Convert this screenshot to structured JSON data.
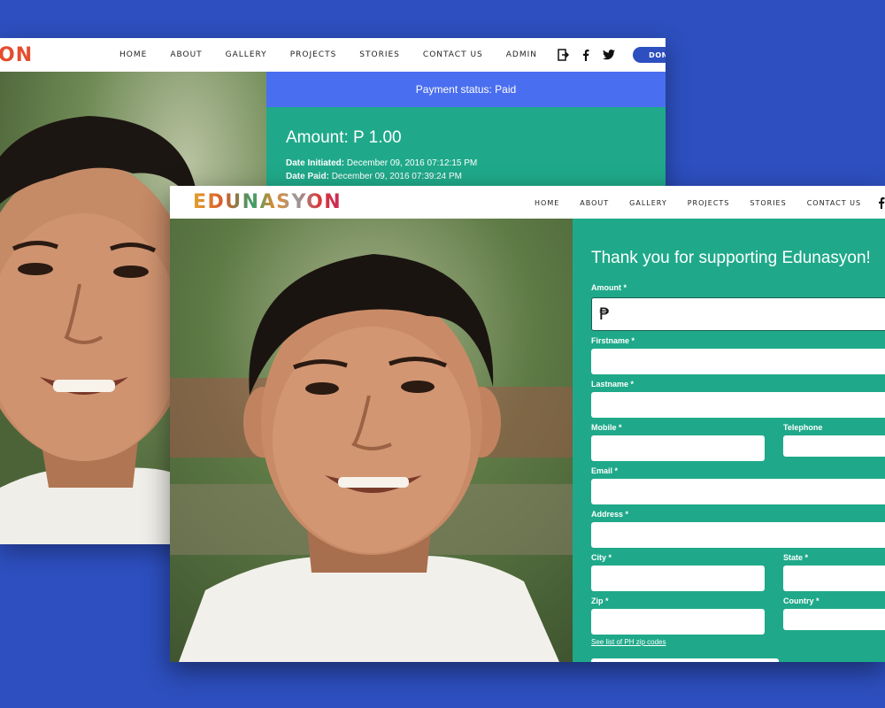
{
  "back": {
    "logo_visible": "ON",
    "nav": [
      "HOME",
      "ABOUT",
      "GALLERY",
      "PROJECTS",
      "STORIES",
      "CONTACT US",
      "ADMIN"
    ],
    "icons": [
      "logout-icon",
      "facebook-icon",
      "twitter-icon"
    ],
    "donate_label": "DONATE",
    "status_text": "Payment status: Paid",
    "amount_text": "Amount: P 1.00",
    "date_initiated_label": "Date Initiated:",
    "date_initiated_value": "December 09, 2016 07:12:15 PM",
    "date_paid_label": "Date Paid:",
    "date_paid_value": "December 09, 2016 07:39:24 PM"
  },
  "front": {
    "logo": "EDUNASYON",
    "nav": [
      "HOME",
      "ABOUT",
      "GALLERY",
      "PROJECTS",
      "STORIES",
      "CONTACT US"
    ],
    "icons": [
      "facebook-icon",
      "twitter-icon"
    ],
    "form_title": "Thank you for supporting Edunasyon!",
    "fields": {
      "amount": "Amount *",
      "firstname": "Firstname *",
      "lastname": "Lastname *",
      "mobile": "Mobile *",
      "telephone": "Telephone",
      "email": "Email *",
      "address": "Address *",
      "city": "City *",
      "state": "State *",
      "zip": "Zip *",
      "country": "Country *"
    },
    "amount_value": "₱",
    "zip_link": "See list of PH zip codes"
  },
  "colors": {
    "background": "#2d4fbf",
    "teal": "#1fa98a",
    "status_blue": "#4a6ef0",
    "donate_blue": "#2d4fbf"
  }
}
